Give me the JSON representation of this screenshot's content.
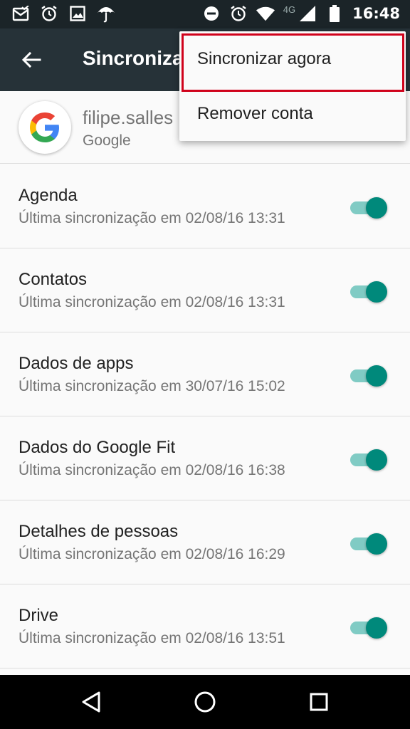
{
  "status_bar": {
    "time": "16:48",
    "network": "4G",
    "left_icons": [
      "mail-check-icon",
      "alarm-icon",
      "image-icon",
      "umbrella-icon"
    ],
    "right_icons": [
      "do-not-disturb-icon",
      "alarm-icon",
      "wifi-icon",
      "signal-icon",
      "battery-icon"
    ]
  },
  "app_bar": {
    "title": "Sincronizar"
  },
  "account": {
    "email": "filipe.salles",
    "type": "Google"
  },
  "sync_items": [
    {
      "title": "Agenda",
      "subtitle": "Última sincronização em 02/08/16 13:31",
      "enabled": true
    },
    {
      "title": "Contatos",
      "subtitle": "Última sincronização em 02/08/16 13:31",
      "enabled": true
    },
    {
      "title": "Dados de apps",
      "subtitle": "Última sincronização em 30/07/16 15:02",
      "enabled": true
    },
    {
      "title": "Dados do Google Fit",
      "subtitle": "Última sincronização em 02/08/16 16:38",
      "enabled": true
    },
    {
      "title": "Detalhes de pessoas",
      "subtitle": "Última sincronização em 02/08/16 16:29",
      "enabled": true
    },
    {
      "title": "Drive",
      "subtitle": "Última sincronização em 02/08/16 13:51",
      "enabled": true
    }
  ],
  "overflow_menu": {
    "items": [
      {
        "label": "Sincronizar agora"
      },
      {
        "label": "Remover conta"
      }
    ]
  },
  "colors": {
    "status_bar": "#1b2428",
    "app_bar": "#263238",
    "accent": "#00897b",
    "highlight": "#d0021b"
  }
}
